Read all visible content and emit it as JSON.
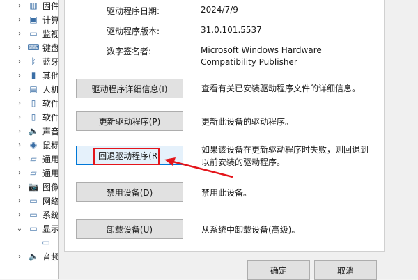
{
  "tree": {
    "items": [
      {
        "label": "固件",
        "icon": "firmware-icon",
        "glyph": "▥",
        "expanded": false,
        "child": false
      },
      {
        "label": "计算",
        "icon": "computer-icon",
        "glyph": "▣",
        "expanded": false,
        "child": false
      },
      {
        "label": "监视",
        "icon": "monitor-icon",
        "glyph": "▭",
        "expanded": false,
        "child": false
      },
      {
        "label": "键盘",
        "icon": "keyboard-icon",
        "glyph": "⌨",
        "expanded": false,
        "child": false
      },
      {
        "label": "蓝牙",
        "icon": "bluetooth-icon",
        "glyph": "ᛒ",
        "expanded": false,
        "child": false
      },
      {
        "label": "其他",
        "icon": "other-devices-icon",
        "glyph": "▮",
        "expanded": false,
        "child": false
      },
      {
        "label": "人机",
        "icon": "hid-icon",
        "glyph": "▤",
        "expanded": false,
        "child": false
      },
      {
        "label": "软件",
        "icon": "software-component-icon",
        "glyph": "▯",
        "expanded": false,
        "child": false
      },
      {
        "label": "软件",
        "icon": "software-device-icon",
        "glyph": "▯",
        "expanded": false,
        "child": false
      },
      {
        "label": "声音",
        "icon": "sound-icon",
        "glyph": "🔈",
        "expanded": false,
        "child": false
      },
      {
        "label": "鼠标",
        "icon": "mouse-icon",
        "glyph": "◉",
        "expanded": false,
        "child": false
      },
      {
        "label": "通用",
        "icon": "usb-controller-icon",
        "glyph": "▱",
        "expanded": false,
        "child": false
      },
      {
        "label": "通用",
        "icon": "usb-device-icon",
        "glyph": "▱",
        "expanded": false,
        "child": false
      },
      {
        "label": "图像",
        "icon": "imaging-icon",
        "glyph": "📷",
        "expanded": false,
        "child": false
      },
      {
        "label": "网络",
        "icon": "network-icon",
        "glyph": "▭",
        "expanded": false,
        "child": false
      },
      {
        "label": "系统",
        "icon": "system-devices-icon",
        "glyph": "▭",
        "expanded": false,
        "child": false
      },
      {
        "label": "显示",
        "icon": "display-adapter-icon",
        "glyph": "▭",
        "expanded": true,
        "child": false
      },
      {
        "label": "",
        "icon": "display-adapter-child-icon",
        "glyph": "▭",
        "expanded": false,
        "child": true
      },
      {
        "label": "音频",
        "icon": "audio-icon",
        "glyph": "🔈",
        "expanded": false,
        "child": false
      }
    ]
  },
  "info": {
    "date_label": "驱动程序日期:",
    "date_value": "2024/7/9",
    "version_label": "驱动程序版本:",
    "version_value": "31.0.101.5537",
    "signer_label": "数字签名者:",
    "signer_value_line1": "Microsoft Windows Hardware",
    "signer_value_line2": "Compatibility Publisher"
  },
  "actions": {
    "details": {
      "label": "驱动程序详细信息(I)",
      "desc": "查看有关已安装驱动程序文件的详细信息。"
    },
    "update": {
      "label": "更新驱动程序(P)",
      "desc": "更新此设备的驱动程序。"
    },
    "rollback": {
      "label": "回退驱动程序(R)",
      "desc_line1": "如果该设备在更新驱动程序时失败，则回退到",
      "desc_line2": "以前安装的驱动程序。"
    },
    "disable": {
      "label": "禁用设备(D)",
      "desc": "禁用此设备。"
    },
    "uninstall": {
      "label": "卸载设备(U)",
      "desc": "从系统中卸载设备(高级)。"
    }
  },
  "footer": {
    "ok_label": "确定",
    "cancel_label": "取消"
  },
  "colors": {
    "annotation_red": "#e4151b",
    "focus_blue": "#0078d7"
  }
}
